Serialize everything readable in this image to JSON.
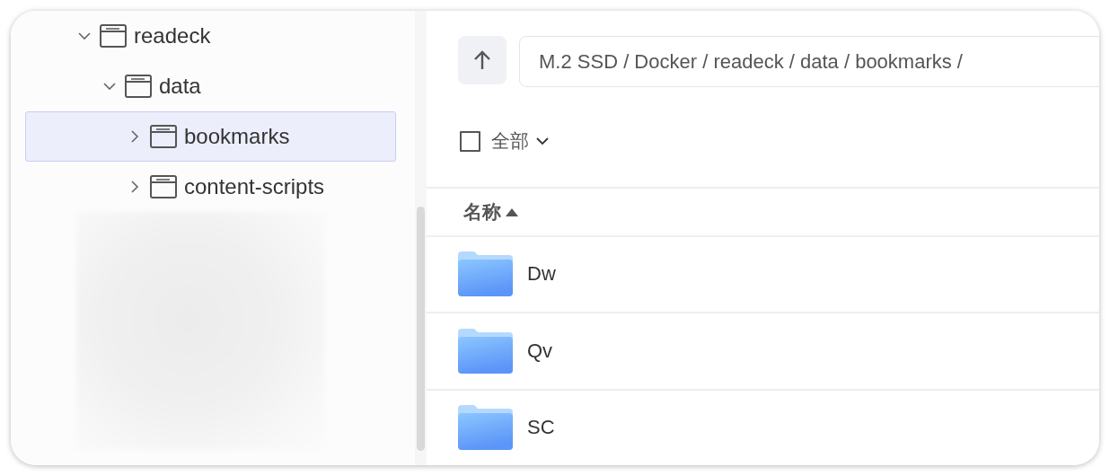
{
  "tree": [
    {
      "label": "readeck",
      "expanded": true,
      "selected": false,
      "children": [
        {
          "label": "data",
          "expanded": true,
          "selected": false,
          "children": [
            {
              "label": "bookmarks",
              "expanded": false,
              "selected": true
            },
            {
              "label": "content-scripts",
              "expanded": false,
              "selected": false
            }
          ]
        }
      ]
    }
  ],
  "path": {
    "value": "M.2 SSD / Docker / readeck / data / bookmarks /"
  },
  "select_all": {
    "label": "全部",
    "checked": false
  },
  "columns": [
    {
      "label": "名称",
      "sort_ascending": true
    }
  ],
  "rows": [
    {
      "name": "Dw"
    },
    {
      "name": "Qv"
    },
    {
      "name": "SC"
    }
  ]
}
